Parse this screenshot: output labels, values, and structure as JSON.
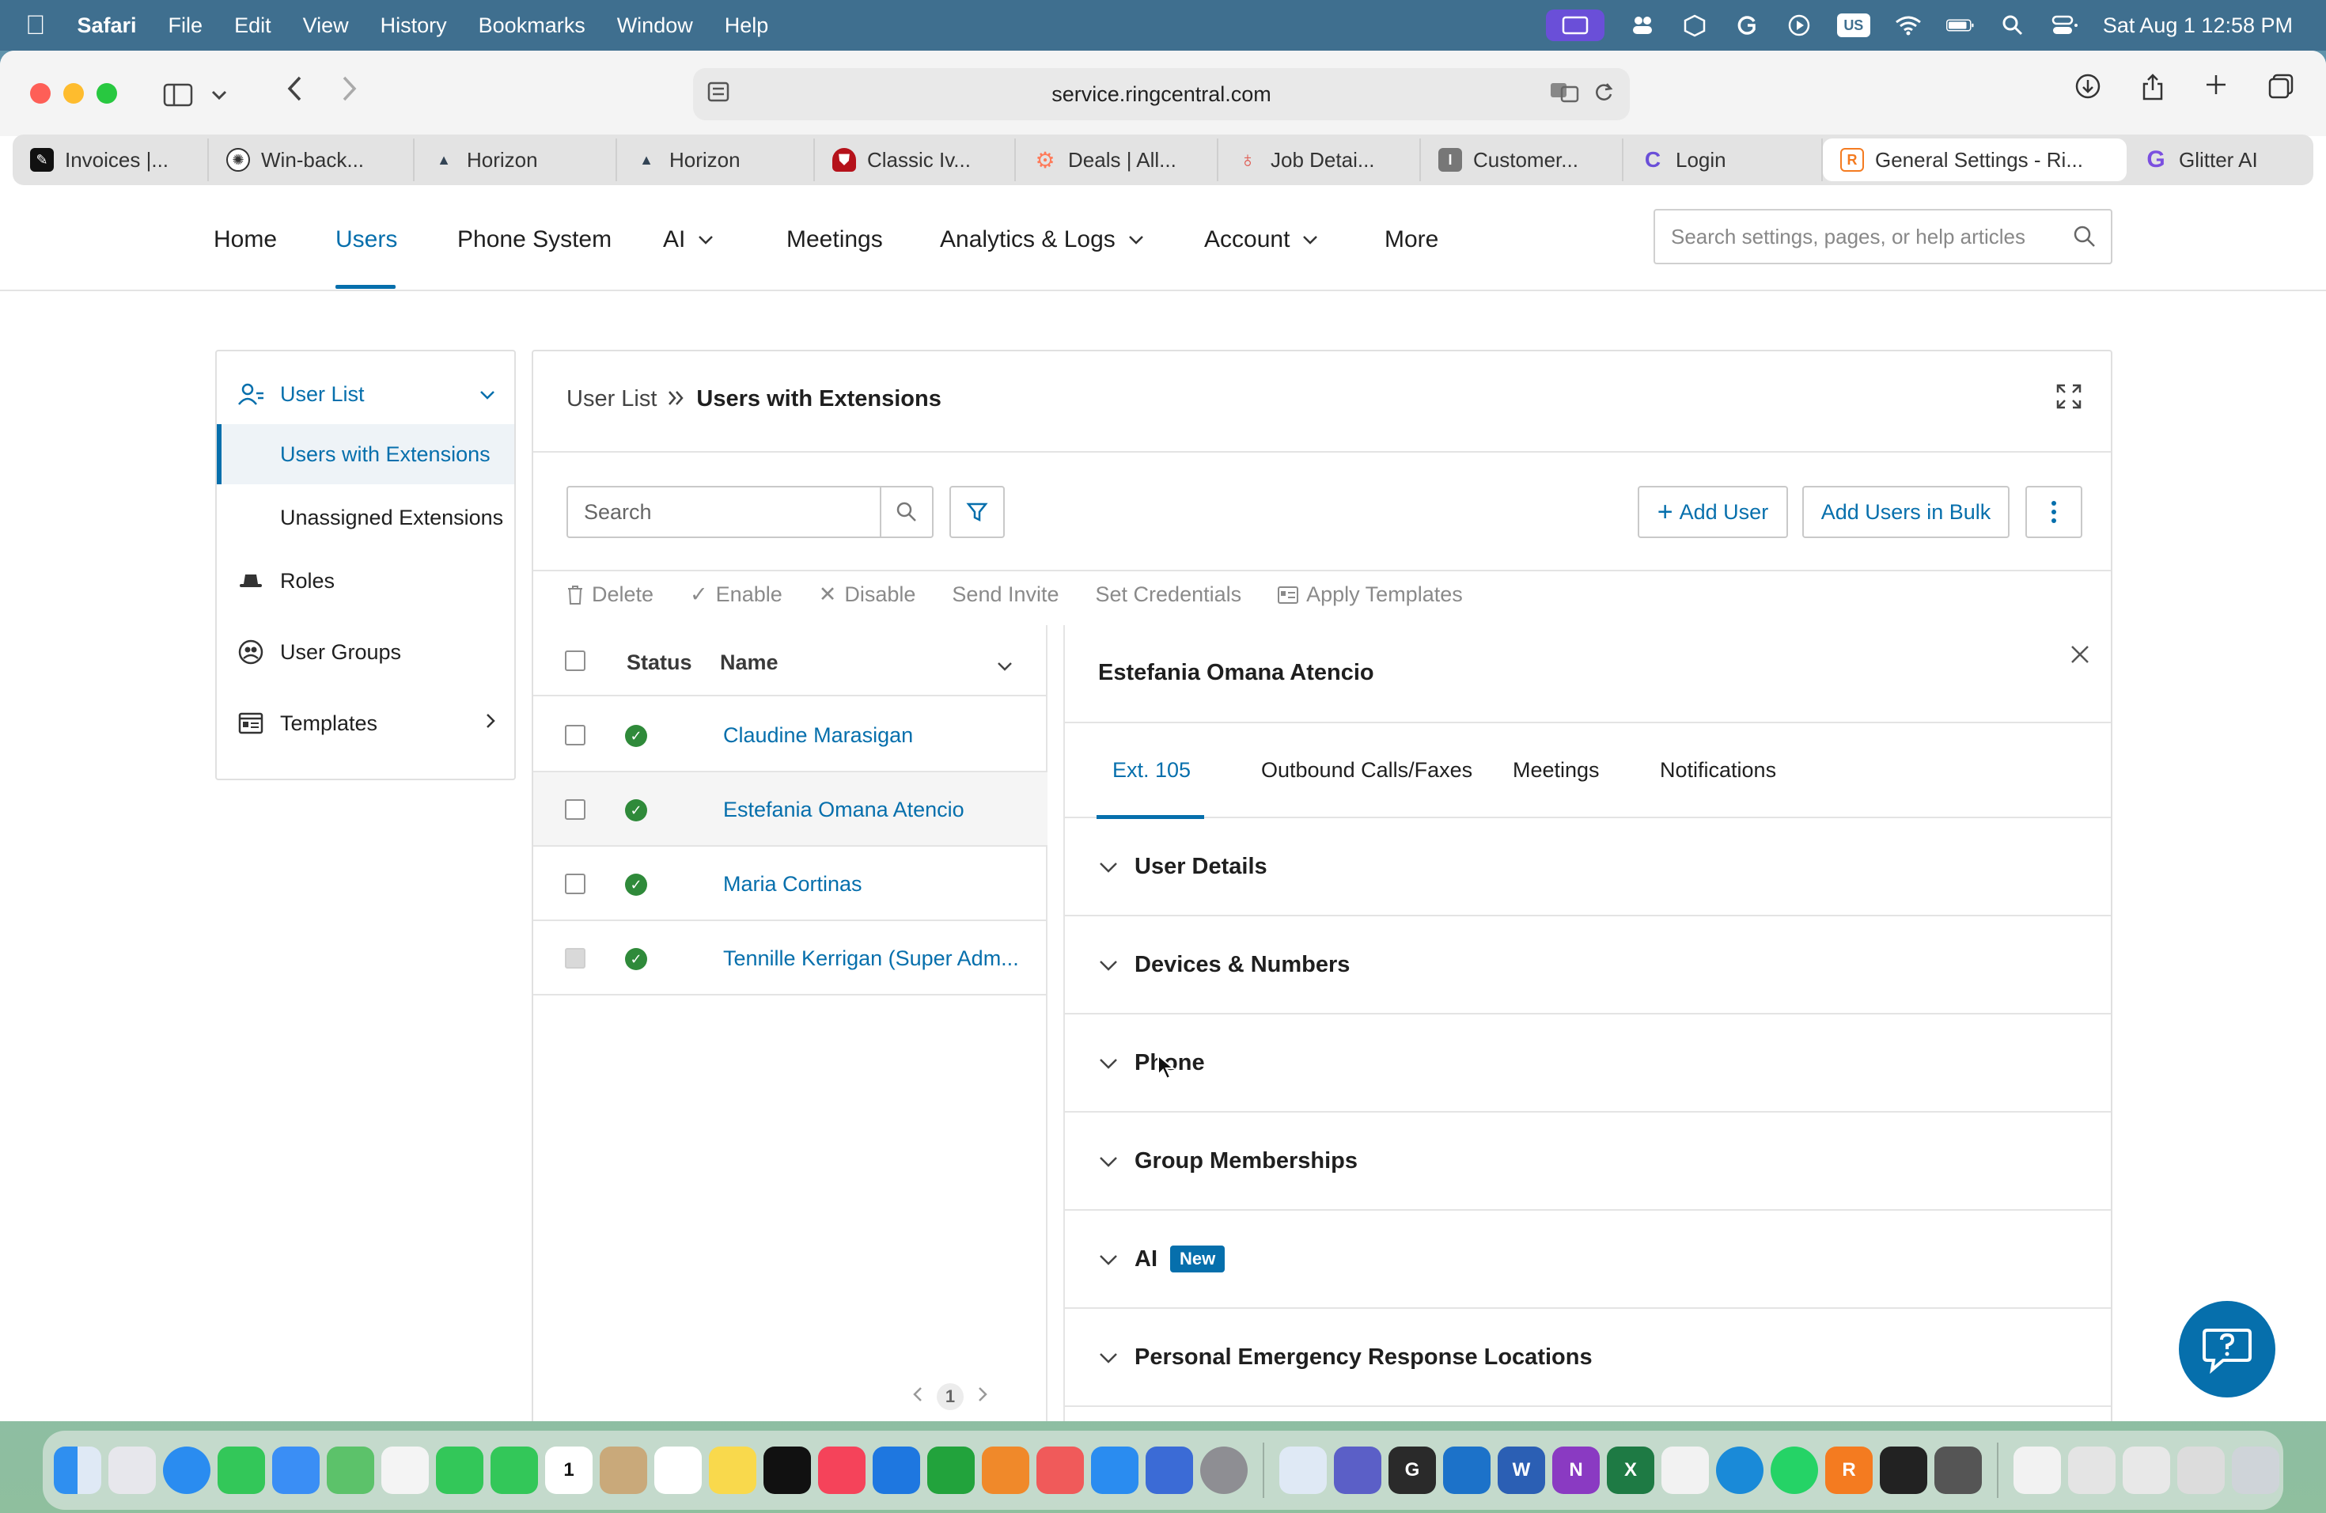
{
  "menubar": {
    "app_name": "Safari",
    "menus": [
      "File",
      "Edit",
      "View",
      "History",
      "Bookmarks",
      "Window",
      "Help"
    ],
    "input_indicator": "US",
    "clock": "Sat Aug 1  12:58 PM"
  },
  "browser": {
    "url": "service.ringcentral.com",
    "tabs": [
      {
        "label": "Invoices |...",
        "icon": "pen-icon",
        "color": "#111111"
      },
      {
        "label": "Win-back...",
        "icon": "openai-icon",
        "color": "#333333"
      },
      {
        "label": "Horizon",
        "icon": "mountain-icon",
        "color": "#334455"
      },
      {
        "label": "Horizon",
        "icon": "mountain-icon",
        "color": "#334455"
      },
      {
        "label": "Classic Iv...",
        "icon": "shield-icon",
        "color": "#b5121b"
      },
      {
        "label": "Deals | All...",
        "icon": "hubspot-icon",
        "color": "#ff7a59"
      },
      {
        "label": "Job Detai...",
        "icon": "pin-icon",
        "color": "#e0544b"
      },
      {
        "label": "Customer...",
        "icon": "letter-i-icon",
        "color": "#777777"
      },
      {
        "label": "Login",
        "icon": "c-logo-icon",
        "color": "#6a4fd8"
      },
      {
        "label": "General Settings - Ri...",
        "icon": "r-logo-icon",
        "color": "#f47b20"
      },
      {
        "label": "Glitter AI",
        "icon": "g-logo-icon",
        "color": "#7b4fe0"
      }
    ]
  },
  "topnav": {
    "items": [
      "Home",
      "Users",
      "Phone System",
      "AI",
      "Meetings",
      "Analytics & Logs",
      "Account",
      "More"
    ],
    "search_placeholder": "Search settings, pages, or help articles"
  },
  "leftnav": {
    "user_list": "User List",
    "users_with_extensions": "Users with Extensions",
    "unassigned_extensions": "Unassigned Extensions",
    "roles": "Roles",
    "user_groups": "User Groups",
    "templates": "Templates"
  },
  "main": {
    "breadcrumb_root": "User List",
    "breadcrumb_current": "Users with Extensions",
    "search_placeholder": "Search",
    "add_user": "Add User",
    "add_users_bulk": "Add Users in Bulk",
    "bulk_actions": {
      "delete": "Delete",
      "enable": "Enable",
      "disable": "Disable",
      "send_invite": "Send Invite",
      "set_credentials": "Set Credentials",
      "apply_templates": "Apply Templates"
    },
    "columns": {
      "status": "Status",
      "name": "Name"
    },
    "users": [
      {
        "name": "Claudine Marasigan"
      },
      {
        "name": "Estefania Omana Atencio"
      },
      {
        "name": "Maria Cortinas"
      },
      {
        "name": "Tennille Kerrigan (Super Adm..."
      }
    ],
    "page": "1"
  },
  "detail": {
    "title": "Estefania Omana Atencio",
    "tabs": [
      "Ext. 105",
      "Outbound Calls/Faxes",
      "Meetings",
      "Notifications"
    ],
    "sections": [
      {
        "title": "User Details"
      },
      {
        "title": "Devices & Numbers"
      },
      {
        "title": "Phone"
      },
      {
        "title": "Group Memberships"
      },
      {
        "title": "AI",
        "badge": "New"
      },
      {
        "title": "Personal Emergency Response Locations"
      }
    ]
  },
  "colors": {
    "accent": "#066fac",
    "status_ok": "#2f8a3a"
  }
}
